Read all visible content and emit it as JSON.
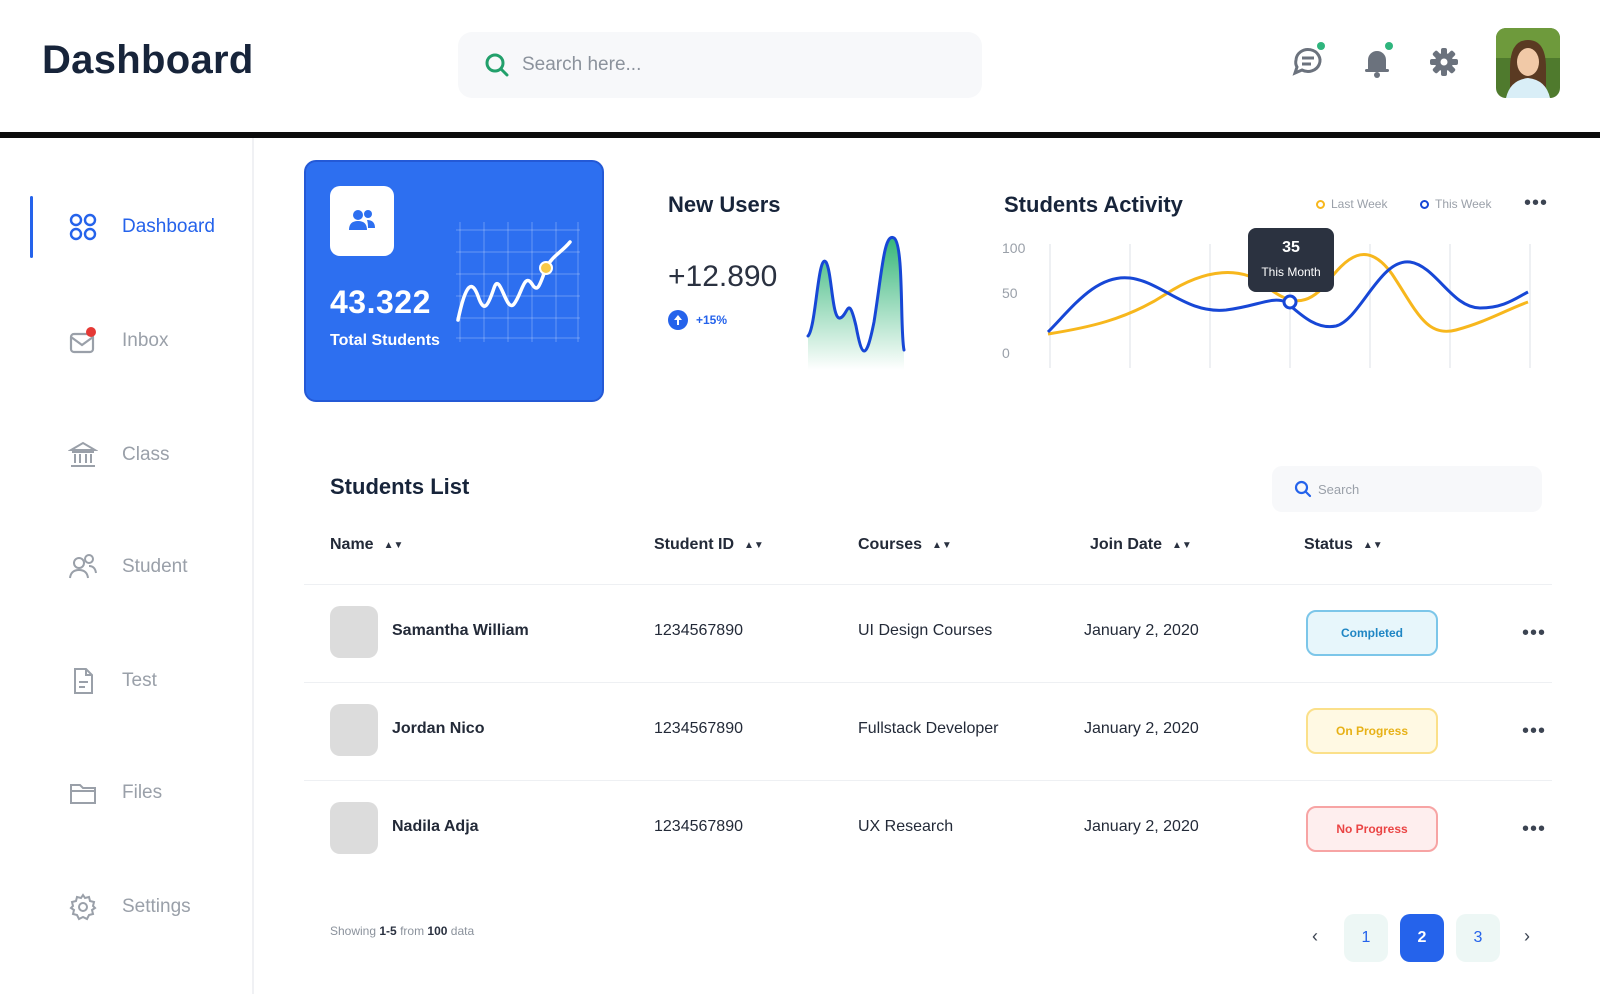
{
  "header": {
    "title": "Dashboard",
    "search_placeholder": "Search here..."
  },
  "sidebar": {
    "items": [
      {
        "label": "Dashboard",
        "icon": "grid-icon",
        "active": true
      },
      {
        "label": "Inbox",
        "icon": "inbox-icon",
        "active": false
      },
      {
        "label": "Class",
        "icon": "bank-icon",
        "active": false
      },
      {
        "label": "Student",
        "icon": "users-icon",
        "active": false
      },
      {
        "label": "Test",
        "icon": "document-icon",
        "active": false
      },
      {
        "label": "Files",
        "icon": "folder-icon",
        "active": false
      },
      {
        "label": "Settings",
        "icon": "gear-icon",
        "active": false
      }
    ]
  },
  "total_students": {
    "value": "43.322",
    "label": "Total Students"
  },
  "new_users": {
    "title": "New Users",
    "value": "+12.890",
    "change": "+15%"
  },
  "students_activity": {
    "title": "Students Activity",
    "legend": [
      "Last Week",
      "This Week"
    ],
    "y_ticks": [
      "100",
      "50",
      "0"
    ],
    "tooltip_value": "35",
    "tooltip_label": "This Month"
  },
  "students_list": {
    "title": "Students List",
    "search_placeholder": "Search",
    "columns": [
      "Name",
      "Student ID",
      "Courses",
      "Join Date",
      "Status"
    ],
    "rows": [
      {
        "name": "Samantha William",
        "id": "1234567890",
        "course": "UI Design Courses",
        "date": "January 2, 2020",
        "status": "Completed"
      },
      {
        "name": "Jordan Nico",
        "id": "1234567890",
        "course": "Fullstack Developer",
        "date": "January 2, 2020",
        "status": "On Progress"
      },
      {
        "name": "Nadila Adja",
        "id": "1234567890",
        "course": "UX Research",
        "date": "January 2, 2020",
        "status": "No Progress"
      }
    ],
    "showing_prefix": "Showing",
    "showing_range": "1-5",
    "showing_mid": "from",
    "showing_total": "100",
    "showing_suffix": "data",
    "pages": [
      "1",
      "2",
      "3"
    ],
    "current_page": "2"
  },
  "colors": {
    "accent": "#2563eb",
    "last_week": "#f7b71d",
    "this_week": "#1747d6",
    "completed": "#1f86c4",
    "on_progress": "#e7b116",
    "no_progress": "#ea4444"
  }
}
